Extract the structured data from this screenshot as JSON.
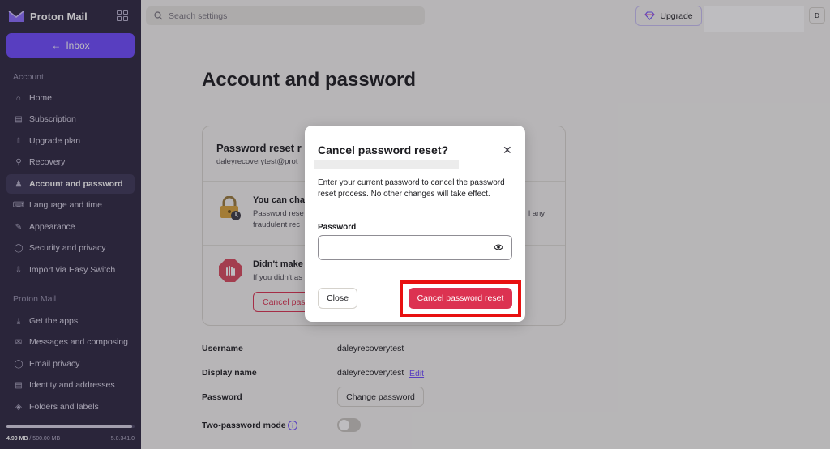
{
  "sidebar": {
    "brand": "Proton Mail",
    "inbox_label": "Inbox",
    "section_account": "Account",
    "account_items": [
      {
        "label": "Home",
        "icon": "home-icon"
      },
      {
        "label": "Subscription",
        "icon": "card-icon"
      },
      {
        "label": "Upgrade plan",
        "icon": "upgrade-icon"
      },
      {
        "label": "Recovery",
        "icon": "key-icon"
      },
      {
        "label": "Account and password",
        "icon": "user-icon"
      },
      {
        "label": "Language and time",
        "icon": "keyboard-icon"
      },
      {
        "label": "Appearance",
        "icon": "paint-icon"
      },
      {
        "label": "Security and privacy",
        "icon": "shield-icon"
      },
      {
        "label": "Import via Easy Switch",
        "icon": "import-icon"
      }
    ],
    "section_mail": "Proton Mail",
    "mail_items": [
      {
        "label": "Get the apps",
        "icon": "download-icon"
      },
      {
        "label": "Messages and composing",
        "icon": "envelope-icon"
      },
      {
        "label": "Email privacy",
        "icon": "shield-icon"
      },
      {
        "label": "Identity and addresses",
        "icon": "id-card-icon"
      },
      {
        "label": "Folders and labels",
        "icon": "tag-icon"
      }
    ],
    "storage_used": "4.90 MB",
    "storage_total": "/ 500.00 MB",
    "storage_fraction": 0.98,
    "version": "5.0.341.0"
  },
  "topbar": {
    "search_placeholder": "Search settings",
    "upgrade_label": "Upgrade",
    "avatar_initial": "D"
  },
  "main": {
    "page_title": "Account and password",
    "card": {
      "title": "Password reset r",
      "email": "daleyrecoverytest@prot",
      "row1_heading": "You can cha",
      "row1_line1": "Password rese",
      "row1_line1_right": "l any",
      "row1_line2": "fraudulent rec",
      "row2_heading": "Didn't make",
      "row2_text": "If you didn't as",
      "cancel_label": "Cancel pas"
    },
    "username_label": "Username",
    "username_value": "daleyrecoverytest",
    "display_name_label": "Display name",
    "display_name_value": "daleyrecoverytest",
    "edit_label": "Edit",
    "password_label": "Password",
    "change_password_label": "Change password",
    "two_password_label": "Two-password mode",
    "two_password_enabled": false
  },
  "modal": {
    "title": "Cancel password reset?",
    "description": "Enter your current password to cancel the password reset process. No other changes will take effect.",
    "password_label": "Password",
    "password_value": "",
    "close_label": "Close",
    "confirm_label": "Cancel password reset"
  },
  "colors": {
    "brand": "#6d4aff",
    "danger": "#dc3251",
    "sidebar_bg": "#2b2640",
    "highlight": "#e81010"
  }
}
